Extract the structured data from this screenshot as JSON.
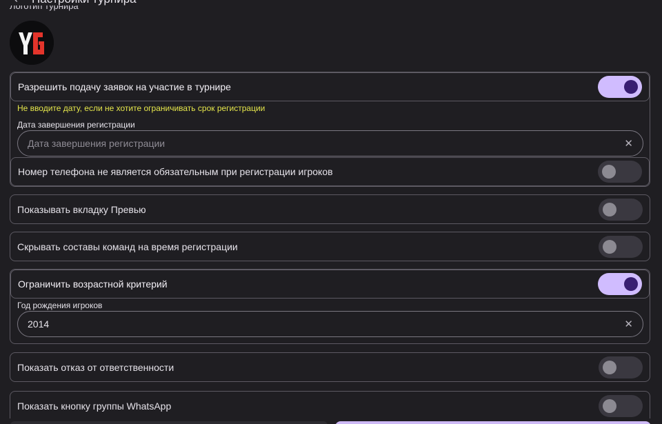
{
  "header": {
    "title": "Настройки турнира",
    "logo_label": "Логотип турнира"
  },
  "logo": {
    "text": "YG"
  },
  "registration": {
    "label": "Разрешить подачу заявок на участие в турнире",
    "enabled": true,
    "hint": "Не вводите дату, если не хотите ограничивать срок регистрации",
    "end_date_label": "Дата завершения регистрации",
    "end_date_value": "",
    "end_date_placeholder": "Дата завершения регистрации",
    "phone_optional_label": "Номер телефона не является обязательным при регистрации игроков",
    "phone_optional_enabled": false
  },
  "preview_tab": {
    "label": "Показывать вкладку Превью",
    "enabled": false
  },
  "hide_rosters": {
    "label": "Скрывать составы команд на время регистрации",
    "enabled": false
  },
  "age_limit": {
    "label": "Ограничить возрастной критерий",
    "enabled": true,
    "birth_year_label": "Год рождения игроков",
    "birth_year_value": "2014"
  },
  "disclaimer": {
    "label": "Показать отказ от ответственности",
    "enabled": false
  },
  "whatsapp": {
    "label": "Показать кнопку группы WhatsApp",
    "enabled": false
  },
  "icons": {
    "back": "arrow-back-icon",
    "clear": "close-icon"
  },
  "colors": {
    "background": "#1f1e22",
    "toggle_on": "#d0bcff",
    "toggle_on_knob": "#381e72",
    "hint": "#e5e64b"
  }
}
